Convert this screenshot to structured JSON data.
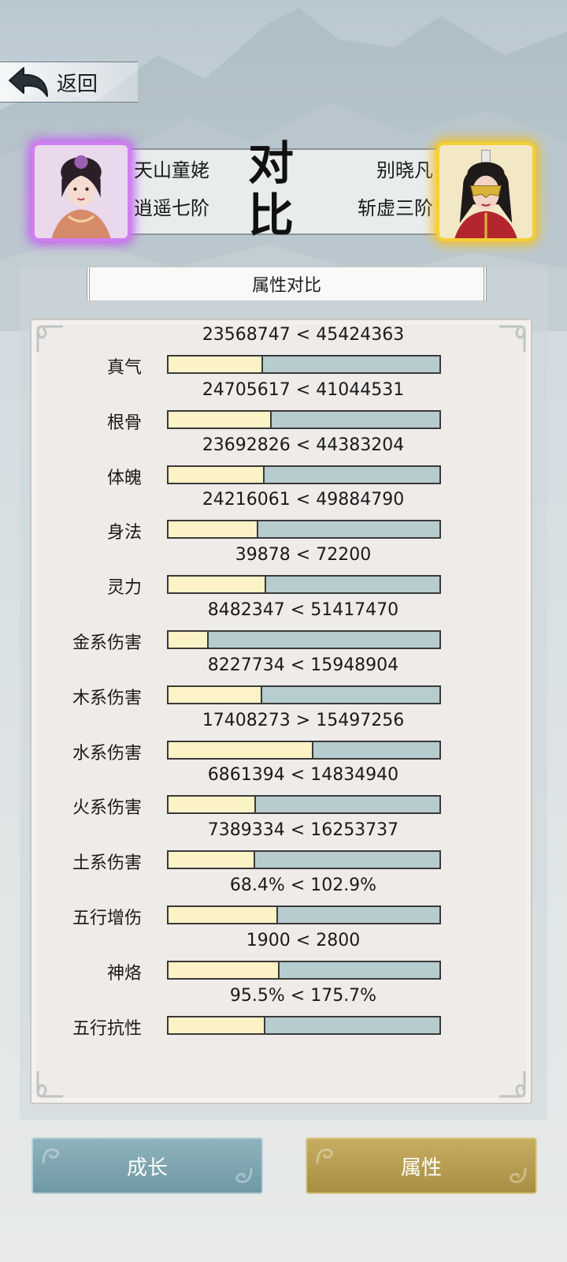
{
  "nav": {
    "back_label": "返回"
  },
  "compare": {
    "title_chars": [
      "对",
      "比"
    ],
    "left": {
      "name": "天山童姥",
      "rank": "逍遥七阶"
    },
    "right": {
      "name": "别晓凡",
      "rank": "斩虚三阶"
    }
  },
  "panel": {
    "title": "属性对比"
  },
  "stats": [
    {
      "label": "真气",
      "left": "23568747",
      "op": "<",
      "right": "45424363",
      "ratio": 0.342
    },
    {
      "label": "根骨",
      "left": "24705617",
      "op": "<",
      "right": "41044531",
      "ratio": 0.376
    },
    {
      "label": "体魄",
      "left": "23692826",
      "op": "<",
      "right": "44383204",
      "ratio": 0.348
    },
    {
      "label": "身法",
      "left": "24216061",
      "op": "<",
      "right": "49884790",
      "ratio": 0.327
    },
    {
      "label": "灵力",
      "left": "39878",
      "op": "<",
      "right": "72200",
      "ratio": 0.356
    },
    {
      "label": "金系伤害",
      "left": "8482347",
      "op": "<",
      "right": "51417470",
      "ratio": 0.142
    },
    {
      "label": "木系伤害",
      "left": "8227734",
      "op": "<",
      "right": "15948904",
      "ratio": 0.34
    },
    {
      "label": "水系伤害",
      "left": "17408273",
      "op": ">",
      "right": "15497256",
      "ratio": 0.529
    },
    {
      "label": "火系伤害",
      "left": "6861394",
      "op": "<",
      "right": "14834940",
      "ratio": 0.316
    },
    {
      "label": "土系伤害",
      "left": "7389334",
      "op": "<",
      "right": "16253737",
      "ratio": 0.313
    },
    {
      "label": "五行增伤",
      "left": "68.4%",
      "op": "<",
      "right": "102.9%",
      "ratio": 0.399
    },
    {
      "label": "神烙",
      "left": "1900",
      "op": "<",
      "right": "2800",
      "ratio": 0.404
    },
    {
      "label": "五行抗性",
      "left": "95.5%",
      "op": "<",
      "right": "175.7%",
      "ratio": 0.352
    }
  ],
  "buttons": {
    "growth": "成长",
    "attributes": "属性"
  },
  "colors": {
    "bar_left": "#fbf2c6",
    "bar_right": "#b7ccce",
    "btn_growth": "#7fa6b1",
    "btn_attr": "#b89e52",
    "left_glow": "#c05cf0",
    "right_glow": "#f4c020"
  }
}
